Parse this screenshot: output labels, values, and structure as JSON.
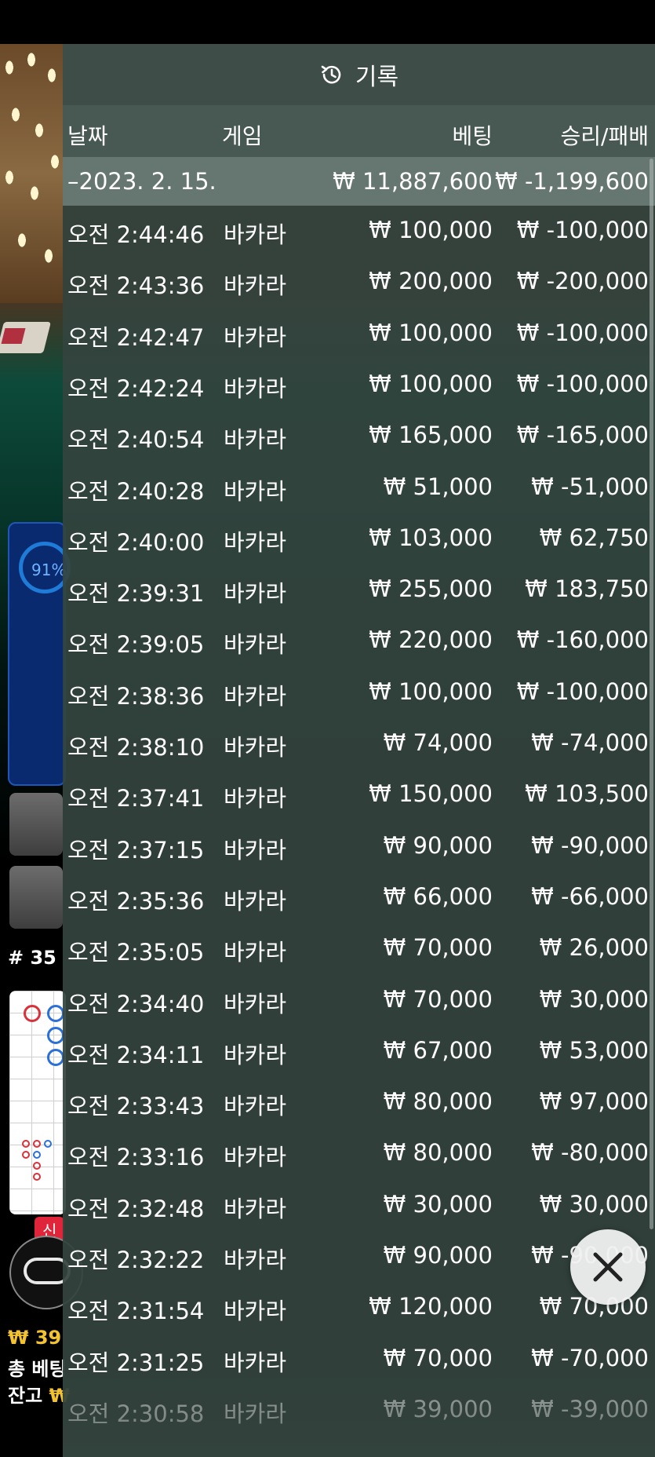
{
  "overlay": {
    "title": "기록",
    "icon": "history-icon",
    "columns": {
      "date": "날짜",
      "game": "게임",
      "bet": "베팅",
      "result": "승리/패배"
    },
    "date_group": {
      "date": "–2023. 2. 15.",
      "total_bet": "₩ 11,887,600",
      "total_result": "₩ -1,199,600"
    },
    "rows": [
      {
        "time": "오전 2:44:46",
        "game": "바카라",
        "bet": "₩ 100,000",
        "result": "₩ -100,000"
      },
      {
        "time": "오전 2:43:36",
        "game": "바카라",
        "bet": "₩ 200,000",
        "result": "₩ -200,000"
      },
      {
        "time": "오전 2:42:47",
        "game": "바카라",
        "bet": "₩ 100,000",
        "result": "₩ -100,000"
      },
      {
        "time": "오전 2:42:24",
        "game": "바카라",
        "bet": "₩ 100,000",
        "result": "₩ -100,000"
      },
      {
        "time": "오전 2:40:54",
        "game": "바카라",
        "bet": "₩ 165,000",
        "result": "₩ -165,000"
      },
      {
        "time": "오전 2:40:28",
        "game": "바카라",
        "bet": "₩ 51,000",
        "result": "₩ -51,000"
      },
      {
        "time": "오전 2:40:00",
        "game": "바카라",
        "bet": "₩ 103,000",
        "result": "₩ 62,750"
      },
      {
        "time": "오전 2:39:31",
        "game": "바카라",
        "bet": "₩ 255,000",
        "result": "₩ 183,750"
      },
      {
        "time": "오전 2:39:05",
        "game": "바카라",
        "bet": "₩ 220,000",
        "result": "₩ -160,000"
      },
      {
        "time": "오전 2:38:36",
        "game": "바카라",
        "bet": "₩ 100,000",
        "result": "₩ -100,000"
      },
      {
        "time": "오전 2:38:10",
        "game": "바카라",
        "bet": "₩ 74,000",
        "result": "₩ -74,000"
      },
      {
        "time": "오전 2:37:41",
        "game": "바카라",
        "bet": "₩ 150,000",
        "result": "₩ 103,500"
      },
      {
        "time": "오전 2:37:15",
        "game": "바카라",
        "bet": "₩ 90,000",
        "result": "₩ -90,000"
      },
      {
        "time": "오전 2:35:36",
        "game": "바카라",
        "bet": "₩ 66,000",
        "result": "₩ -66,000"
      },
      {
        "time": "오전 2:35:05",
        "game": "바카라",
        "bet": "₩ 70,000",
        "result": "₩ 26,000"
      },
      {
        "time": "오전 2:34:40",
        "game": "바카라",
        "bet": "₩ 70,000",
        "result": "₩ 30,000"
      },
      {
        "time": "오전 2:34:11",
        "game": "바카라",
        "bet": "₩ 67,000",
        "result": "₩ 53,000"
      },
      {
        "time": "오전 2:33:43",
        "game": "바카라",
        "bet": "₩ 80,000",
        "result": "₩ 97,000"
      },
      {
        "time": "오전 2:33:16",
        "game": "바카라",
        "bet": "₩ 80,000",
        "result": "₩ -80,000"
      },
      {
        "time": "오전 2:32:48",
        "game": "바카라",
        "bet": "₩ 30,000",
        "result": "₩ 30,000"
      },
      {
        "time": "오전 2:32:22",
        "game": "바카라",
        "bet": "₩ 90,000",
        "result": "₩ -90,000"
      },
      {
        "time": "오전 2:31:54",
        "game": "바카라",
        "bet": "₩ 120,000",
        "result": "₩ 70,000"
      },
      {
        "time": "오전 2:31:25",
        "game": "바카라",
        "bet": "₩ 70,000",
        "result": "₩ -70,000"
      },
      {
        "time": "오전 2:30:58",
        "game": "바카라",
        "bet": "₩ 39,000",
        "result": "₩ -39,000"
      }
    ],
    "close_icon": "close-icon"
  },
  "background": {
    "percent": "91%",
    "round": "# 35",
    "new_badge": "신",
    "balance_prefix": "₩ 39",
    "total_bet_label": "총 베팅",
    "balance_label": "잔고",
    "balance_currency": "₩"
  },
  "colors": {
    "overlay": "#34443e",
    "header": "#3e4e48",
    "date_row": "#697a74",
    "accent_blue": "#1f56b8",
    "gold": "#f2c230"
  }
}
